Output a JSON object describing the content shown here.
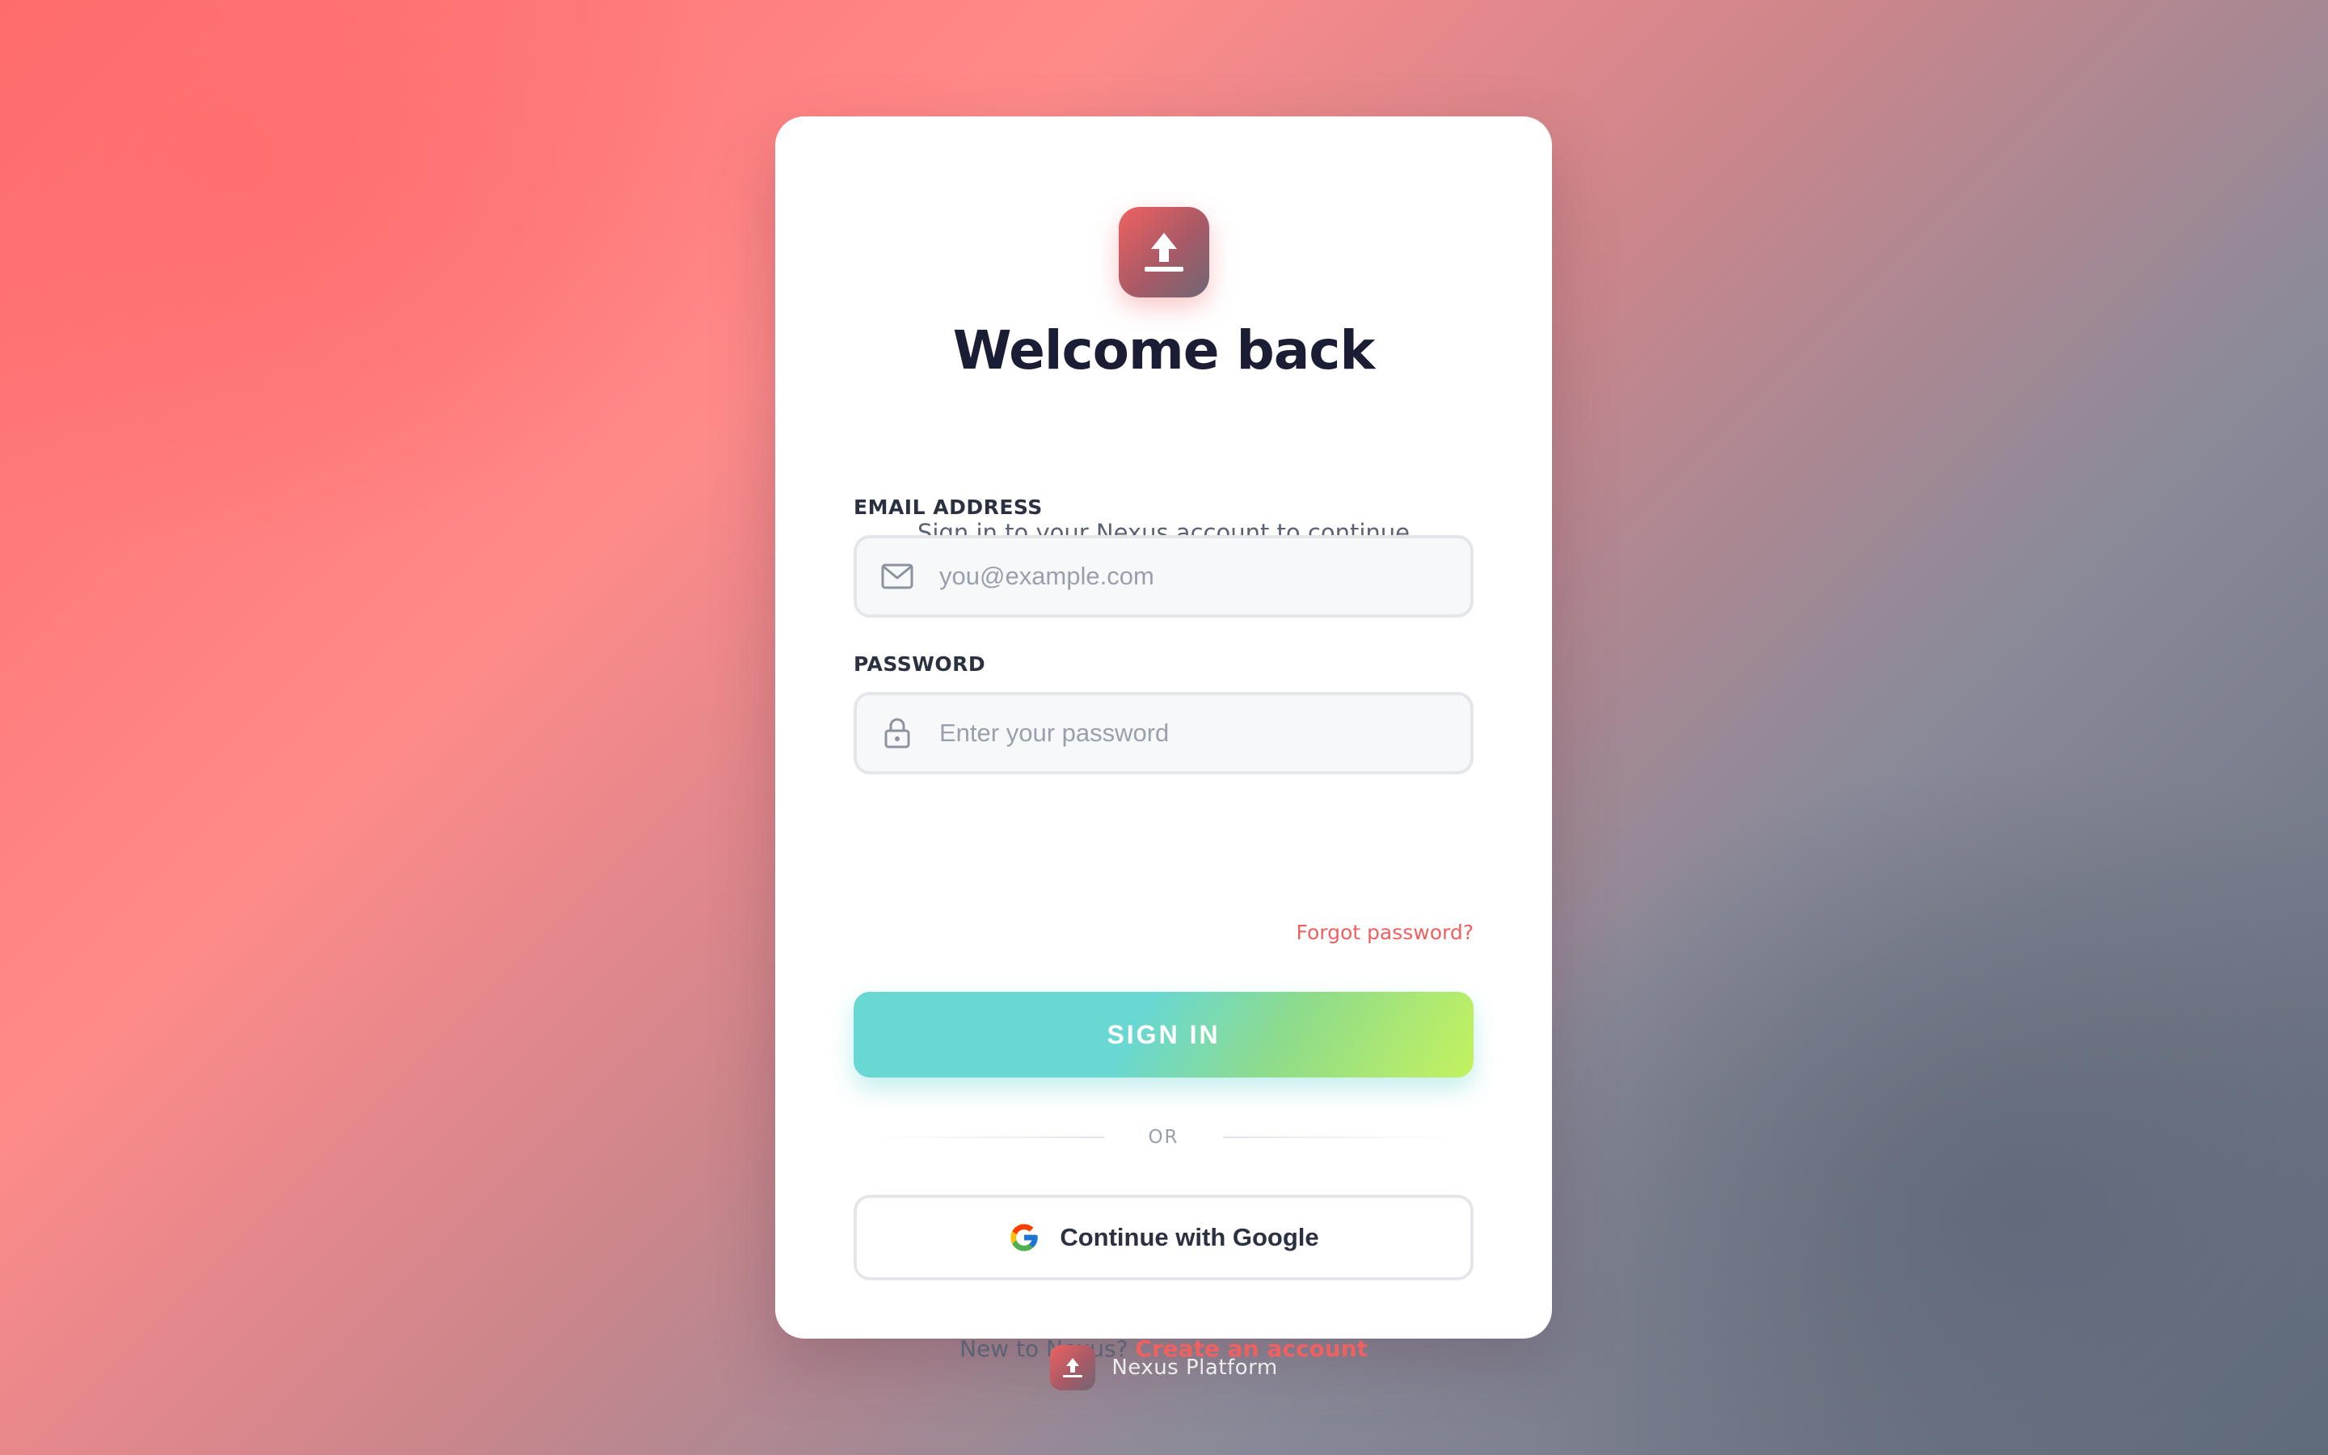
{
  "login": {
    "title": "Welcome back",
    "subtitle": "Sign in to your Nexus account to continue",
    "email_label": "EMAIL ADDRESS",
    "email_placeholder": "you@example.com",
    "email_value": "",
    "password_label": "PASSWORD",
    "password_placeholder": "Enter your password",
    "password_value": "",
    "forgot_link": "Forgot password?",
    "signin_button": "SIGN IN",
    "divider_text": "OR",
    "google_button": "Continue with Google",
    "signup_prompt": "New to Nexus?",
    "signup_link": "Create an account"
  },
  "footer": {
    "brand": "Nexus Platform"
  },
  "icons": {
    "logo": "upload-icon",
    "email": "mail-icon",
    "password": "lock-icon",
    "google": "google-icon"
  },
  "colors": {
    "accent": "#ef6161",
    "button_gradient_start": "#69d8d2",
    "button_gradient_end": "#c4f25f",
    "title": "#1a1d33"
  }
}
